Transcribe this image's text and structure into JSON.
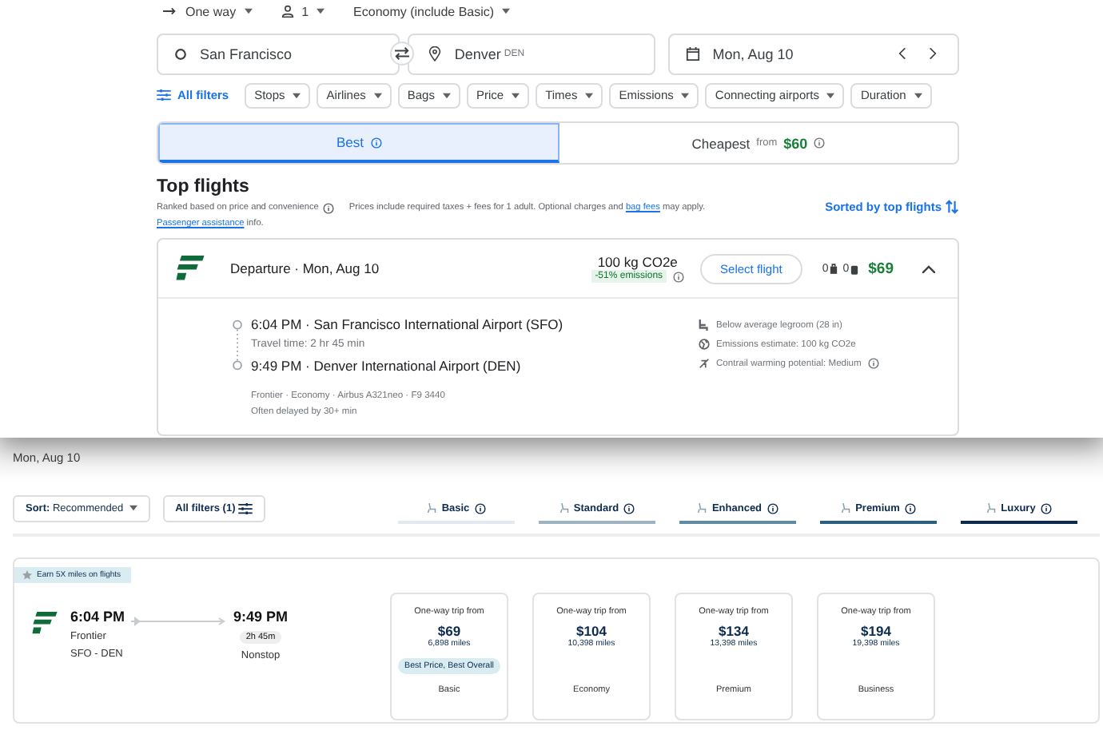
{
  "trip_options": [
    {
      "kind": "trip_type",
      "label": "One way"
    },
    {
      "kind": "passengers",
      "label": "1"
    },
    {
      "kind": "cabin",
      "label": "Economy (include Basic)"
    }
  ],
  "search": {
    "origin": "San Francisco",
    "destination": "Denver",
    "destination_code": "DEN",
    "date": "Mon, Aug 10"
  },
  "filters": {
    "all_label": "All filters",
    "chips": [
      "Stops",
      "Airlines",
      "Bags",
      "Price",
      "Times",
      "Emissions",
      "Connecting airports",
      "Duration"
    ]
  },
  "sort_tabs": [
    {
      "label": "Best",
      "selected": true
    },
    {
      "label": "Cheapest",
      "from_label": "from",
      "price": "$60",
      "selected": false
    }
  ],
  "top_flights": {
    "title": "Top flights",
    "ranking_note": "Ranked based on price and convenience",
    "price_note": "Prices include required taxes + fees for 1 adult. Optional charges and",
    "bag_fees_link": "bag fees",
    "price_note_end": "may apply.",
    "assistance_link": "Passenger assistance",
    "assistance_end": "info.",
    "sort_link": "Sorted by top flights"
  },
  "flight": {
    "separator": "·",
    "departure_label": "Departure",
    "date": "Mon, Aug 10",
    "emissions": "100 kg CO2e",
    "emissions_change": "-51% emissions",
    "select_label": "Select flight",
    "carry_on": "0",
    "checked_bags": "0",
    "price": "$69",
    "expanded": true,
    "dep_time": "6:04 PM",
    "dep_airport": "San Francisco International Airport (SFO)",
    "travel_time": "Travel time: 2 hr 45 min",
    "arr_time": "9:49 PM",
    "arr_airport": "Denver International Airport (DEN)",
    "details": "Frontier · Economy · Airbus A321neo · F9 3440",
    "delay": "Often delayed by 30+ min",
    "amenities": [
      {
        "kind": "legroom",
        "text": "Below average legroom (28 in)"
      },
      {
        "kind": "emissions",
        "text": "Emissions estimate: 100 kg CO2e"
      },
      {
        "kind": "contrail",
        "text": "Contrail warming potential: Medium"
      }
    ]
  },
  "fare_page": {
    "date": "Mon, Aug 10",
    "sort_label": "Sort:",
    "sort_value": "Recommended",
    "filters_label": "All filters (1)",
    "tiers": [
      {
        "label": "Basic",
        "color": "#e3eaee"
      },
      {
        "label": "Standard",
        "color": "#9fb4c3"
      },
      {
        "label": "Enhanced",
        "color": "#5f8aa4"
      },
      {
        "label": "Premium",
        "color": "#2d5f82"
      },
      {
        "label": "Luxury",
        "color": "#0d2b4e"
      }
    ],
    "result": {
      "badge": "Earn 5X miles on flights",
      "dep_time": "6:04 PM",
      "arr_time": "9:49 PM",
      "airline": "Frontier",
      "route": "SFO - DEN",
      "duration": "2h 45m",
      "stops": "Nonstop",
      "fares": [
        {
          "heading": "One-way trip from",
          "price": "$69",
          "miles": "6,898 miles",
          "badge": "Best Price, Best Overall",
          "cabin": "Basic"
        },
        {
          "heading": "One-way trip from",
          "price": "$104",
          "miles": "10,398 miles",
          "cabin": "Economy"
        },
        {
          "heading": "One-way trip from",
          "price": "$134",
          "miles": "13,398 miles",
          "cabin": "Premium"
        },
        {
          "heading": "One-way trip from",
          "price": "$194",
          "miles": "19,398 miles",
          "cabin": "Business"
        }
      ]
    }
  }
}
